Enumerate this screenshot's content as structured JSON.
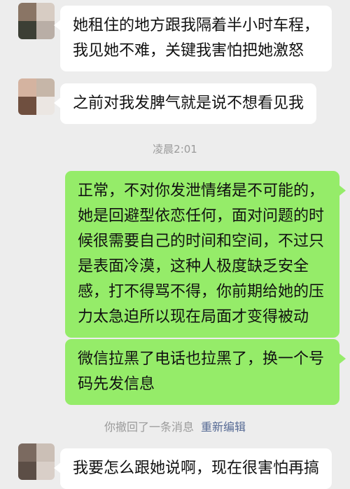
{
  "colors": {
    "background": "#ededed",
    "incoming_bubble": "#ffffff",
    "outgoing_bubble": "#95ec69",
    "system_text": "#9b9b9b",
    "link": "#576b95"
  },
  "messages": [
    {
      "direction": "incoming",
      "avatar": "pixelated-avatar",
      "lines": [
        "她租住的地方跟我隔着半小时车程，",
        "我见她不难，关键我害怕把她激怒"
      ]
    },
    {
      "direction": "incoming",
      "avatar": "pixelated-avatar",
      "lines": [
        "之前对我发脾气就是说不想看见我"
      ]
    },
    {
      "direction": "system",
      "time": "凌晨2:01"
    },
    {
      "direction": "outgoing",
      "lines": [
        "正常，不对你发泄情绪是不可能的，",
        "她是回避型依恋任何，面对问题的时",
        "候很需要自己的时间和空间，不过只",
        "是表面冷漠，这种人极度缺乏安全",
        "感，打不得骂不得，你前期给她的压",
        "力太急迫所以现在局面才变得被动"
      ]
    },
    {
      "direction": "outgoing",
      "lines": [
        "微信拉黑了电话也拉黑了，换一个号",
        "码先发信息"
      ]
    },
    {
      "direction": "system",
      "recall_text": "你撤回了一条消息",
      "edit_label": "重新编辑"
    },
    {
      "direction": "incoming",
      "avatar": "pixelated-avatar",
      "lines": [
        "我要怎么跟她说啊，现在很害怕再搞"
      ]
    }
  ]
}
